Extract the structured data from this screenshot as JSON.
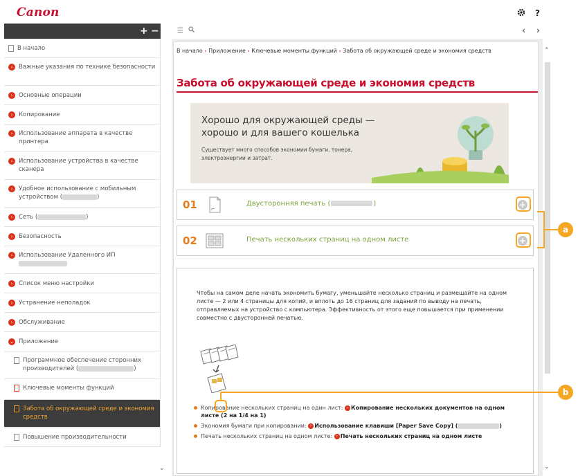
{
  "header": {
    "logo": "Canon",
    "settings_icon": "gear-icon",
    "help_label": "?"
  },
  "sidebar": {
    "expand_label": "+",
    "collapse_label": "−",
    "items": [
      {
        "label": "В начало",
        "icon": "page"
      },
      {
        "label": "Важные указания по технике безопасности",
        "icon": "bullet"
      },
      {
        "label": "Основные операции",
        "icon": "bullet"
      },
      {
        "label": "Копирование",
        "icon": "bullet"
      },
      {
        "label": "Использование аппарата в качестве принтера",
        "icon": "bullet"
      },
      {
        "label": "Использование устройства в качестве сканера",
        "icon": "bullet"
      },
      {
        "label": "Удобное использование с мобильным устройством (",
        "icon": "bullet",
        "suffix": ")"
      },
      {
        "label": "Сеть (",
        "icon": "bullet",
        "suffix": ")"
      },
      {
        "label": "Безопасность",
        "icon": "bullet"
      },
      {
        "label": "Использование Удаленного ИП",
        "icon": "bullet"
      },
      {
        "label": "Список меню настройки",
        "icon": "bullet"
      },
      {
        "label": "Устранение неполадок",
        "icon": "bullet"
      },
      {
        "label": "Обслуживание",
        "icon": "bullet"
      },
      {
        "label": "Приложение",
        "icon": "bullet-open"
      },
      {
        "label": "Программное обеспечение сторонних производителей (",
        "icon": "page",
        "suffix": ")"
      },
      {
        "label": "Ключевые моменты функций",
        "icon": "page-red"
      },
      {
        "label": "Забота об окружающей среде и экономия средств",
        "icon": "page"
      },
      {
        "label": "Повышение производительности",
        "icon": "page"
      }
    ]
  },
  "toolbar": {
    "prev": "‹",
    "next": "›"
  },
  "breadcrumb": {
    "parts": [
      "В начало",
      "Приложение",
      "Ключевые моменты функций",
      "Забота об окружающей среде и экономия средств"
    ],
    "sep": "›"
  },
  "page": {
    "title": "Забота об окружающей среде и экономия средств",
    "banner_heading_1": "Хорошо для окружающей среды —",
    "banner_heading_2": "хорошо и для вашего кошелька",
    "banner_text_1": "Существует много способов экономии бумаги, тонера,",
    "banner_text_2": "электроэнергии и затрат.",
    "features": [
      {
        "num": "01",
        "label": "Двусторонняя печать (",
        "suffix": ")",
        "icon": "duplex-page-icon"
      },
      {
        "num": "02",
        "label": "Печать нескольких страниц на одном листе",
        "suffix": "",
        "icon": "multi-page-icon"
      }
    ],
    "expand_glyph": "+",
    "paragraph": "Чтобы на самом деле начать экономить бумагу, уменьшайте несколько страниц и размещайте на одном листе — 2 или 4 страницы для копий, и вплоть до 16 страниц для заданий по выводу на печать, отправляемых на устройство с компьютера. Эффективность от этого еще повышается при применении совместно с двусторонней печатью.",
    "bullets": [
      {
        "text": "Копирование нескольких страниц на один лист: ",
        "link": "Копирование нескольких документов на одном листе (2 на 1/4 на 1)"
      },
      {
        "text": "Экономия бумаги при копировании: ",
        "link": "Использование клавиши [Paper Save Copy] (",
        "suffix": ")"
      },
      {
        "text": "Печать нескольких страниц на одном листе: ",
        "link": "Печать нескольких страниц на одном листе"
      }
    ]
  },
  "callouts": {
    "a": "a",
    "b": "b"
  },
  "colors": {
    "accent": "#c8102e",
    "orange": "#f5a623",
    "green": "#7aa23b",
    "dark": "#3c3c3c"
  }
}
